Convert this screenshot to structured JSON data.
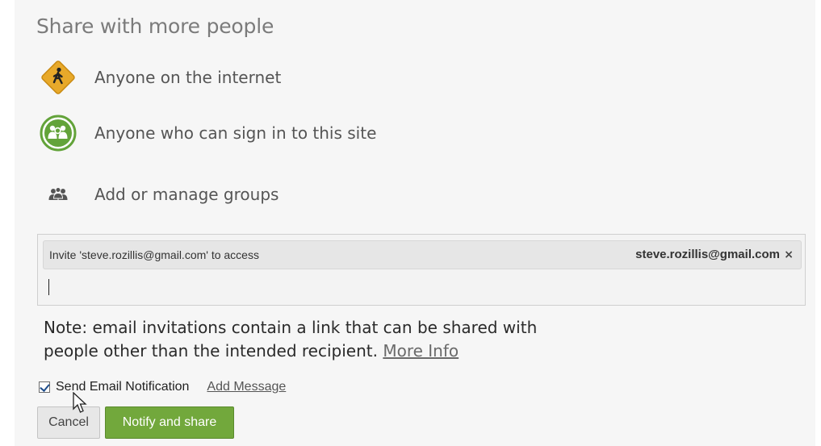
{
  "dialog": {
    "title": "Share with more people"
  },
  "options": [
    {
      "label": "Anyone on the internet",
      "icon": "pedestrian-sign-icon",
      "color": "#e8a92a"
    },
    {
      "label": "Anyone who can sign in to this site",
      "icon": "people-group-icon",
      "color": "#63a33a"
    },
    {
      "label": "Add or manage groups",
      "icon": "groups-icon",
      "color": "#555555"
    }
  ],
  "invite": {
    "text": "Invite 'steve.rozillis@gmail.com' to access",
    "email": "steve.rozillis@gmail.com",
    "remove": "×",
    "input_value": ""
  },
  "note": {
    "text": "Note: email invitations contain a link that can be shared with people other than the intended recipient.",
    "link": "More Info"
  },
  "notification": {
    "checked": true,
    "label": "Send Email Notification",
    "add_message": "Add Message"
  },
  "buttons": {
    "cancel": "Cancel",
    "share": "Notify and share"
  },
  "colors": {
    "share_button": "#72a83c",
    "panel_bg": "#f6f6f6"
  }
}
